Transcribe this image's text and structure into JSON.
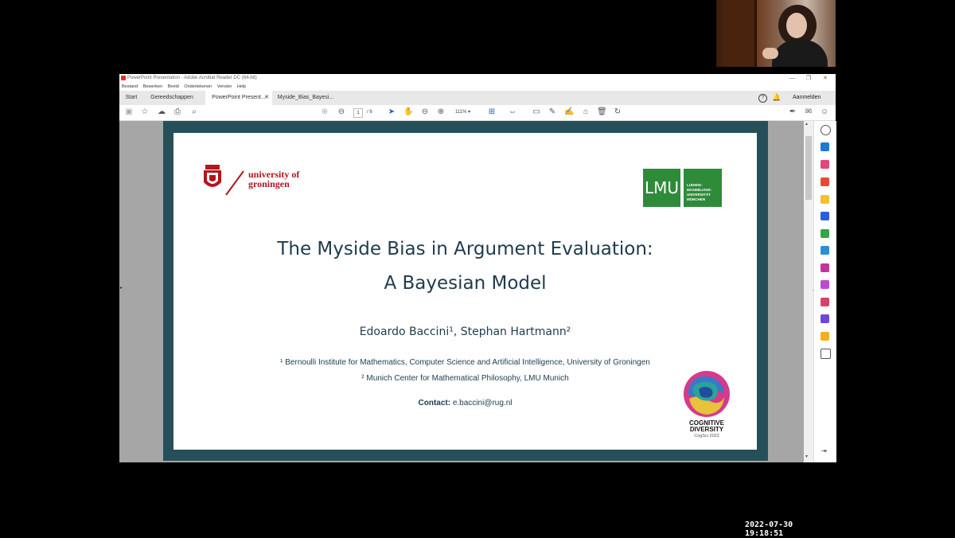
{
  "window": {
    "title": "PowerPoint Presentation - Adobe Acrobat Reader DC (64-bit)",
    "controls": [
      "—",
      "❐",
      "✕"
    ]
  },
  "menu": [
    "Bestand",
    "Bewerken",
    "Beeld",
    "Ondertekenen",
    "Venster",
    "Help"
  ],
  "tabs": [
    {
      "label": "Start"
    },
    {
      "label": "Gereedschappen"
    },
    {
      "label": "PowerPoint Present..."
    },
    {
      "label": "Myside_Bias_Bayesi..."
    }
  ],
  "signin": "Aanmelden",
  "toolbar": {
    "page_current": "1",
    "page_total": "/ 6",
    "zoom": "111%"
  },
  "slide": {
    "rug_logo_line1": "university of",
    "rug_logo_line2": "groningen",
    "lmu_logo_big": "LMU",
    "lmu_logo_line1": "LUDWIG-",
    "lmu_logo_line2": "MAXIMILIANS-",
    "lmu_logo_line3": "UNIVERSITÄT",
    "lmu_logo_line4": "MÜNCHEN",
    "title_line1": "The Myside Bias in Argument Evaluation:",
    "title_line2": "A Bayesian Model",
    "authors": "Edoardo Baccini¹, Stephan Hartmann²",
    "affil1": "¹ Bernoulli Institute for Mathematics, Computer Science and Artificial Intelligence, University of Groningen",
    "affil2": "² Munich Center for Mathematical Philosophy, LMU Munich",
    "contact_label": "Contact:",
    "contact_email": "e.baccini@rug.nl",
    "cogsci_line1": "COGNITIVE",
    "cogsci_line2": "DIVERSITY",
    "cogsci_line3": "CogSci 2022"
  },
  "timestamp": "2022-07-30  19:18:51",
  "colors": {
    "slide_frame": "#274f5a",
    "rug_red": "#b3161d",
    "lmu_green": "#2e8b3a",
    "title_navy": "#1f3b4d"
  }
}
